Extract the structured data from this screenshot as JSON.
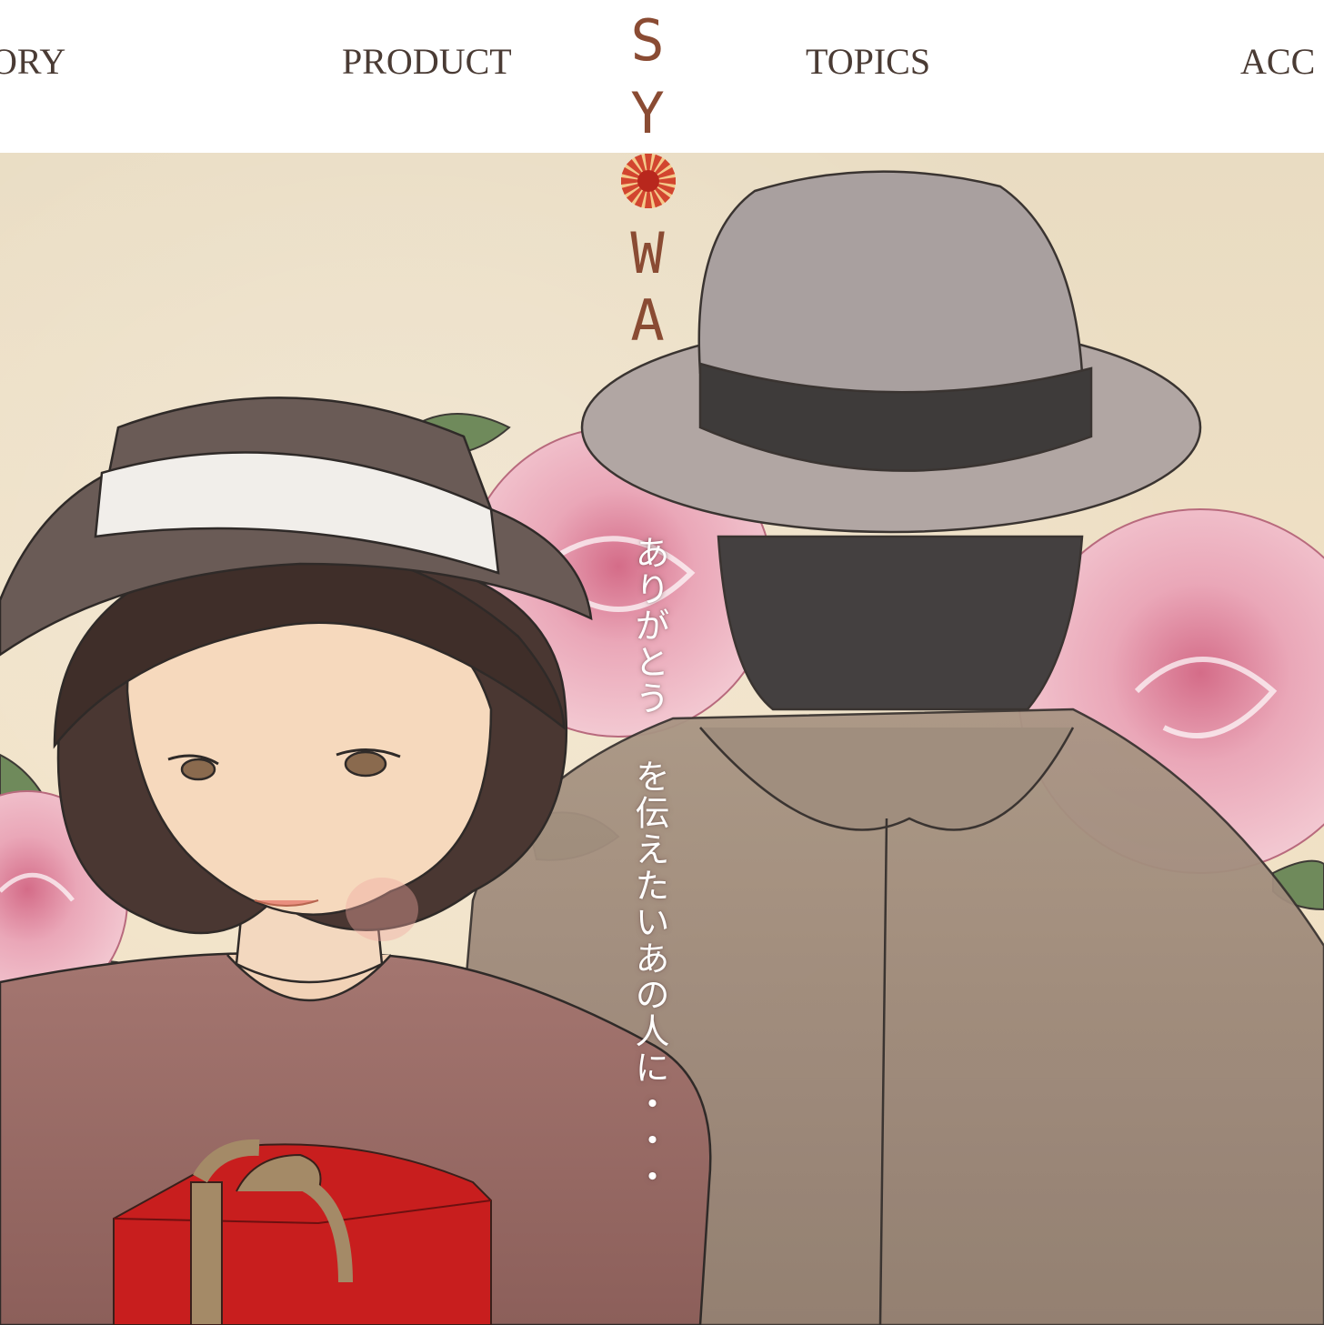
{
  "nav": {
    "items": [
      {
        "label": "ORY"
      },
      {
        "label": "PRODUCT"
      },
      {
        "label": "TOPICS"
      },
      {
        "label": "ACC"
      }
    ]
  },
  "logo": {
    "letters": [
      "S",
      "Y",
      "W",
      "A"
    ],
    "emblem_color": "#c8372a",
    "text_color": "#8a4b33"
  },
  "hero": {
    "tagline": "ありがとう を伝えたいあの人に・・・"
  },
  "colors": {
    "nav_text": "#4a3b34",
    "background_paper": "#eee0c5",
    "gift_box": "#c81e1e",
    "rose": "#e8a3b4"
  }
}
